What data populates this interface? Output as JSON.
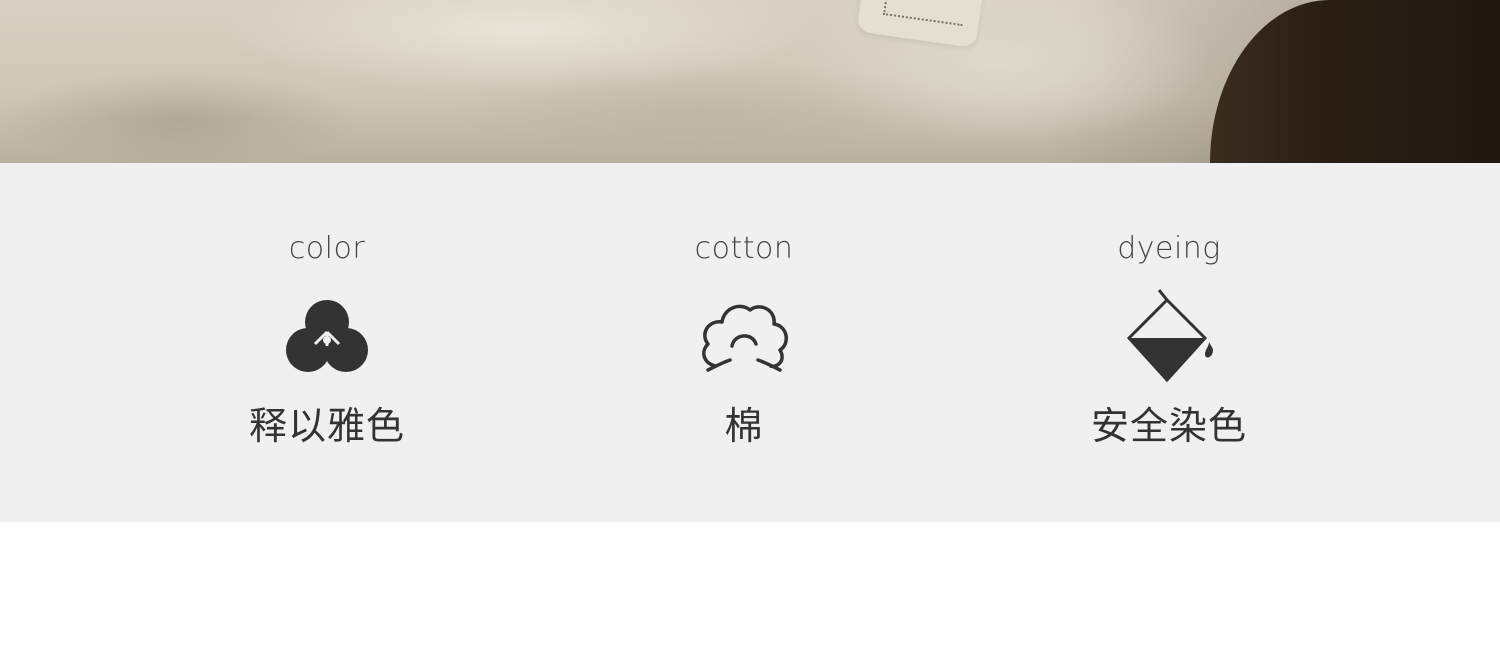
{
  "features": [
    {
      "en": "color",
      "zh": "释以雅色",
      "icon": "three-circles-icon"
    },
    {
      "en": "cotton",
      "zh": "棉",
      "icon": "cotton-icon"
    },
    {
      "en": "dyeing",
      "zh": "安全染色",
      "icon": "dye-bucket-icon"
    }
  ],
  "colors": {
    "band": "#f0f0f0",
    "icon": "#333333",
    "text": "#444444"
  }
}
